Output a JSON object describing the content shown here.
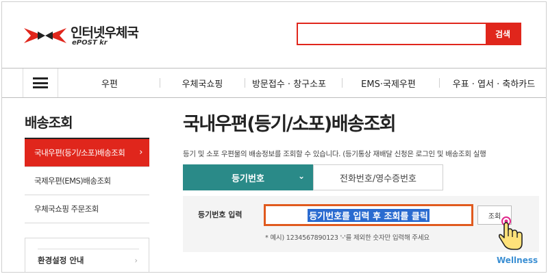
{
  "header": {
    "logo_main": "인터넷우체국",
    "logo_sub": "ePOST kr",
    "search_placeholder": "",
    "search_button": "검색"
  },
  "nav": {
    "items": [
      "우편",
      "우체국쇼핑",
      "방문접수 · 창구소포",
      "EMS·국제우편",
      "우표 · 엽서 · 축하카드"
    ]
  },
  "sidebar": {
    "title": "배송조회",
    "items": [
      {
        "label": "국내우편(등기/소포)배송조회",
        "active": true
      },
      {
        "label": "국제우편(EMS)배송조회",
        "active": false
      },
      {
        "label": "우체국쇼핑 주문조회",
        "active": false
      }
    ],
    "settings_label": "환경설정 안내"
  },
  "main": {
    "title": "국내우편(등기/소포)배송조회",
    "description": "등기 및 소포 우편물의 배송정보를 조회할 수 있습니다. (등기통상 재배달 신청은 로그인 및 배송조회 실행",
    "tabs": [
      {
        "label": "등기번호",
        "active": true
      },
      {
        "label": "전화번호/영수증번호",
        "active": false
      }
    ],
    "form": {
      "label": "등기번호 입력",
      "input_value": "등기번호를 입력 후 조회를 클릭",
      "query_button": "조회",
      "hint": "* 예시) 1234567890123 '-'를 제외한 숫자만 입력해 주세요"
    }
  },
  "watermark": "Wellness",
  "colors": {
    "brand_red": "#e0261c",
    "tab_teal": "#2a8a88",
    "highlight_blue": "#2a6bd0",
    "input_border": "#e05a1e"
  }
}
